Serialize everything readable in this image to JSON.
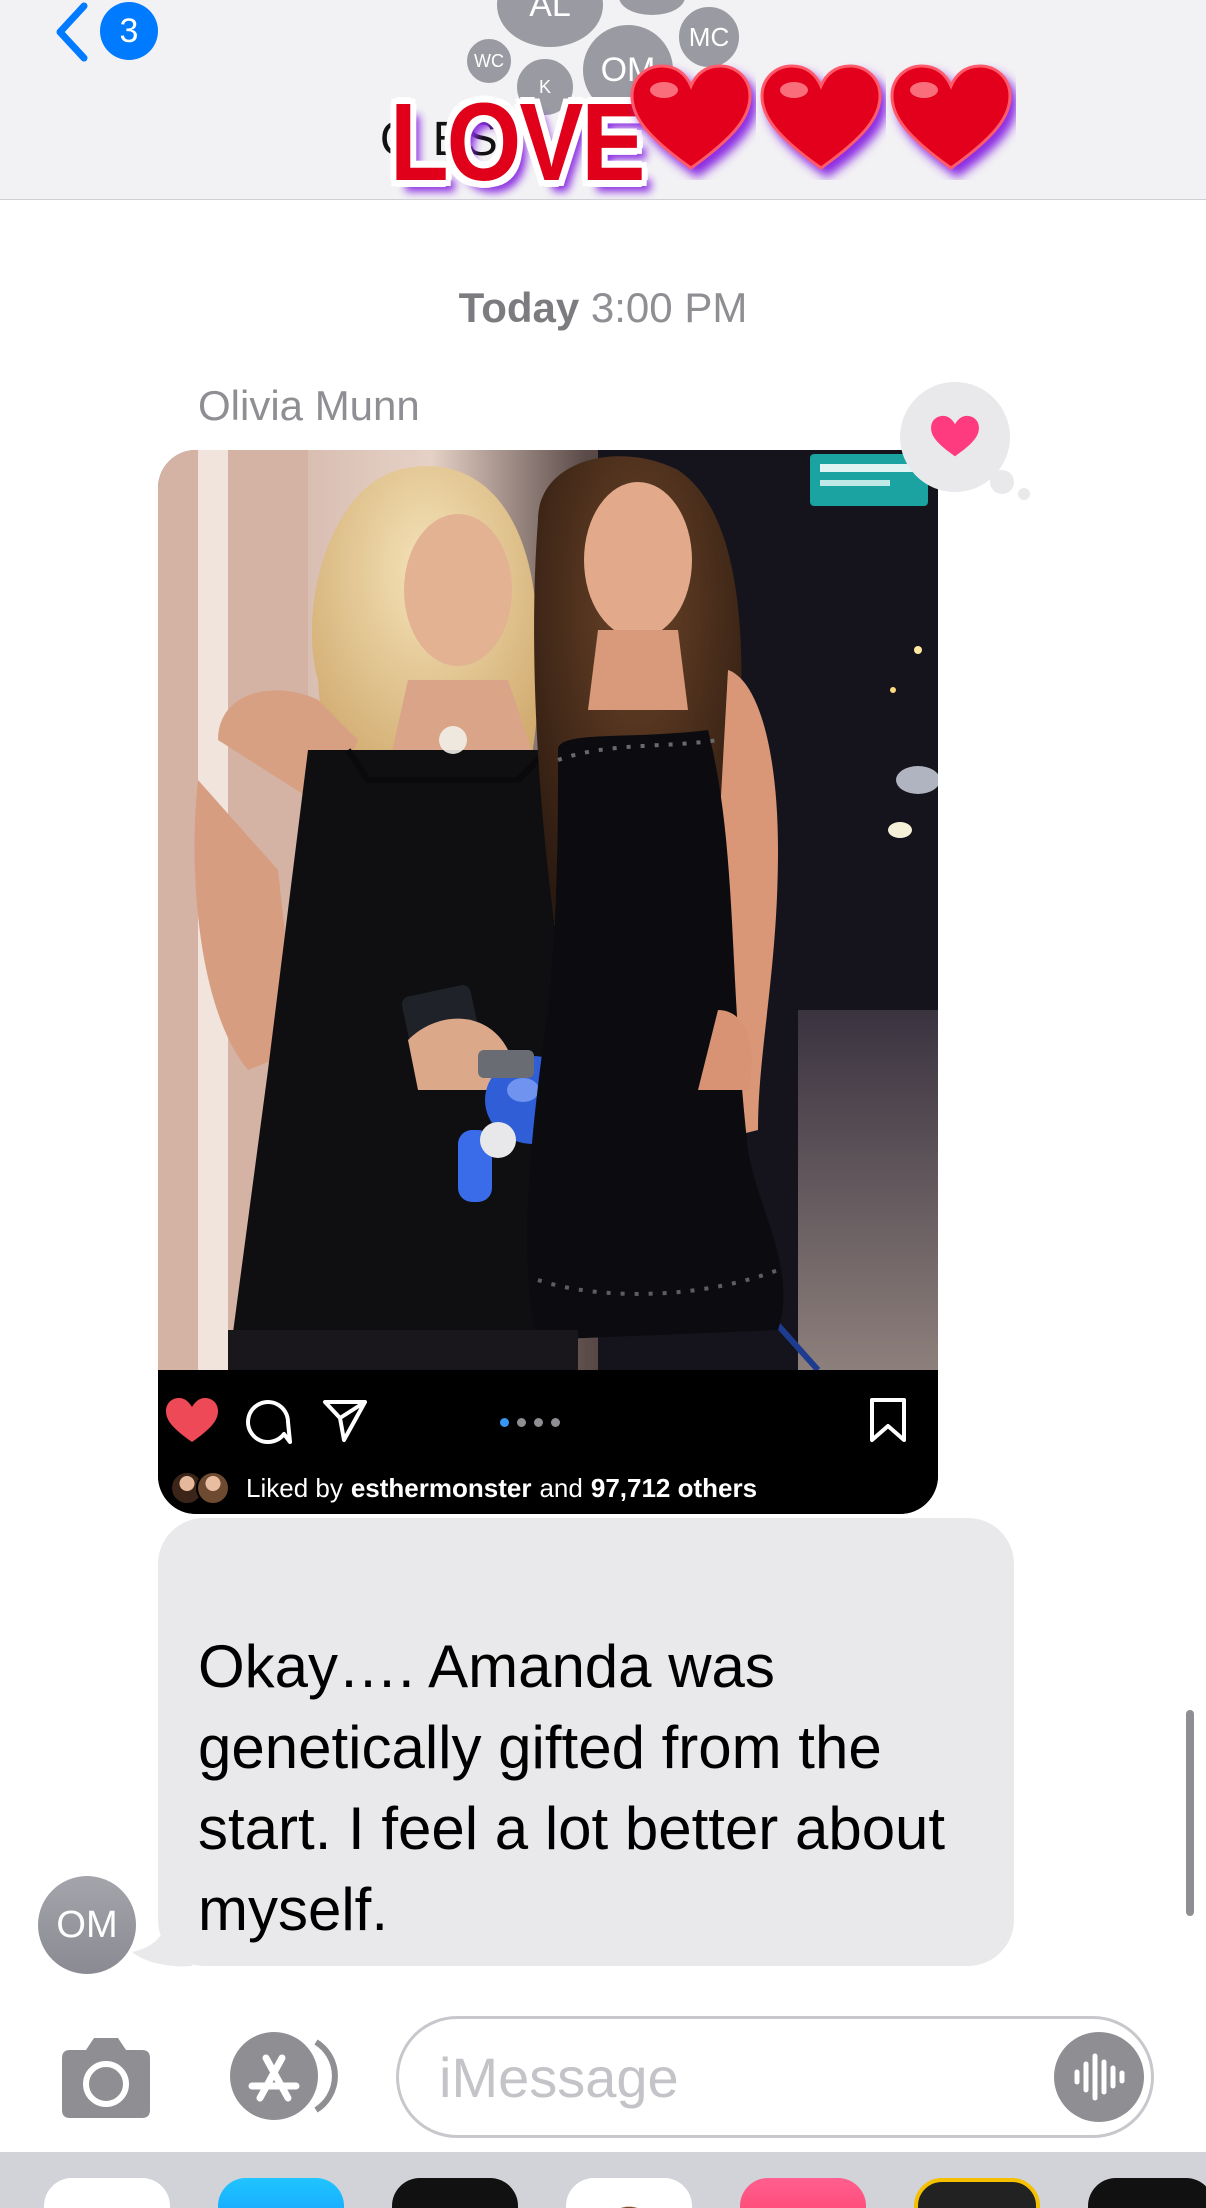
{
  "header": {
    "back_badge": "3",
    "avatars": [
      {
        "initials": "AL"
      },
      {
        "initials": ""
      },
      {
        "initials": "MC"
      },
      {
        "initials": "WC"
      },
      {
        "initials": "K"
      },
      {
        "initials": "OM"
      }
    ],
    "title_partial": "Q           ES",
    "sticker": {
      "text": "LOVE",
      "hearts": 3,
      "text_color": "#e0001a",
      "glow_color": "#8a2be2"
    }
  },
  "conversation": {
    "timestamp_day": "Today",
    "timestamp_time": "3:00 PM",
    "sender_name": "Olivia Munn",
    "tapback": "heart-icon",
    "post": {
      "liked_prefix": "Liked by",
      "liked_user": "esthermonster",
      "liked_middle": "and",
      "liked_count": "97,712 others",
      "carousel_pages": 4,
      "carousel_active": 1
    },
    "message": {
      "text": "Okay…. Amanda was genetically gifted from the start. I feel a lot better about myself."
    },
    "sender_avatar_initials": "OM"
  },
  "composer": {
    "placeholder": "iMessage"
  },
  "colors": {
    "accent": "#007aff",
    "bubble_received": "#e9e9eb",
    "tapback_heart": "#ff3b7f",
    "ig_like_red": "#ed4956"
  }
}
